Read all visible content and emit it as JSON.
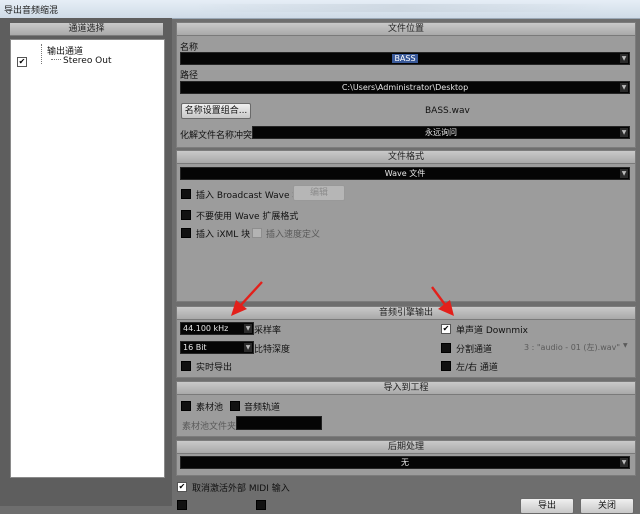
{
  "window": {
    "title": "导出音频缩混"
  },
  "left": {
    "header": "通道选择",
    "tree": {
      "group": "输出通道",
      "item": "Stereo Out",
      "item_checked": true
    }
  },
  "file_location": {
    "header": "文件位置",
    "name_label": "名称",
    "name_value": "BASS",
    "path_label": "路径",
    "path_value": "C:\\Users\\Administrator\\Desktop",
    "naming_button": "名称设置组合...",
    "filename_preview": "BASS.wav",
    "conflict_label": "化解文件名称冲突",
    "conflict_value": "永远询问"
  },
  "file_format": {
    "header": "文件格式",
    "format_value": "Wave 文件",
    "broadcast_wave": "插入 Broadcast Wave 块",
    "edit_button": "编辑",
    "no_wave_ext": "不要使用 Wave 扩展格式",
    "ixml": "插入 iXML 块",
    "tempo_def": "插入速度定义"
  },
  "engine_output": {
    "header": "音频引擎输出",
    "sample_rate_value": "44.100 kHz",
    "sample_rate_label": "采样率",
    "bit_depth_value": "16 Bit",
    "bit_depth_label": "比特深度",
    "realtime": "实时导出",
    "mono_downmix": "单声道 Downmix",
    "split_channels": "分割通道",
    "split_value": "3 : \"audio - 01 (左).wav\"",
    "lr_channels": "左/右 通道"
  },
  "import_project": {
    "header": "导入到工程",
    "pool": "素材池",
    "audio_track": "音频轨道",
    "pool_folder": "素材池文件夹"
  },
  "post_processing": {
    "header": "后期处理",
    "value": "无"
  },
  "midi": {
    "deactivate_external_midi": "取消激活外部 MIDI 输入"
  },
  "footer": {
    "export_button": "导出",
    "close_button": "关闭"
  },
  "colors": {
    "annotation_arrow": "#e3201b",
    "background": "#6e6e6e",
    "section": "#9c9c9c"
  }
}
